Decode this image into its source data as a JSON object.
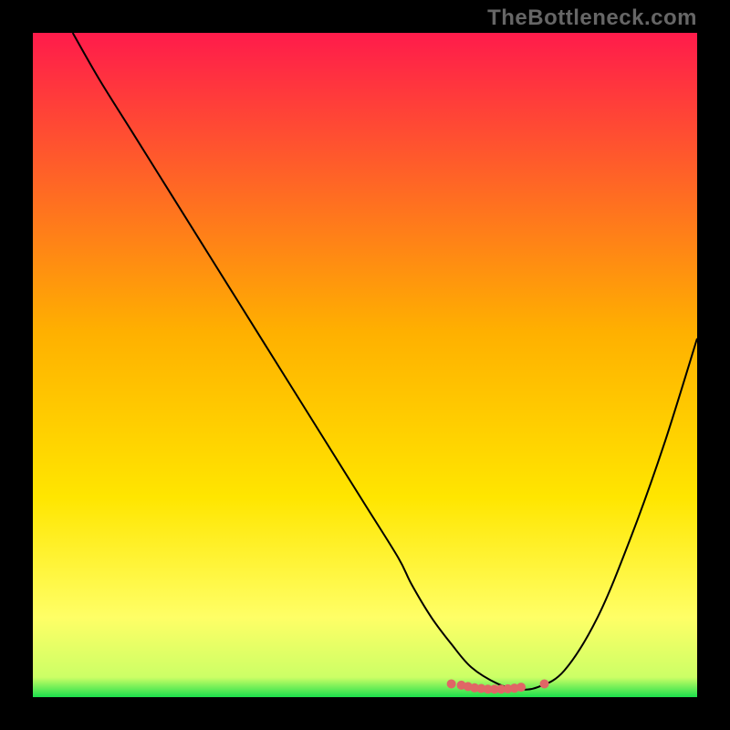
{
  "watermark": "TheBottleneck.com",
  "chart_data": {
    "type": "line",
    "title": "",
    "xlabel": "",
    "ylabel": "",
    "xlim": [
      0,
      100
    ],
    "ylim": [
      0,
      100
    ],
    "grid": false,
    "legend": false,
    "gradient": {
      "stops": [
        {
          "offset": 0.0,
          "color": "#ff1b4b"
        },
        {
          "offset": 0.45,
          "color": "#ffb000"
        },
        {
          "offset": 0.7,
          "color": "#ffe600"
        },
        {
          "offset": 0.88,
          "color": "#ffff66"
        },
        {
          "offset": 0.97,
          "color": "#ccff66"
        },
        {
          "offset": 1.0,
          "color": "#1bdf4c"
        }
      ]
    },
    "series": [
      {
        "name": "bottleneck-curve",
        "color": "#000000",
        "width": 2,
        "x": [
          6,
          10,
          15,
          20,
          25,
          30,
          35,
          40,
          45,
          50,
          55,
          57,
          60,
          63,
          66,
          70,
          73,
          76,
          80,
          85,
          90,
          95,
          100
        ],
        "y": [
          100,
          93,
          85,
          77,
          69,
          61,
          53,
          45,
          37,
          29,
          21,
          17,
          12,
          8,
          4.5,
          2,
          1.2,
          1.5,
          4,
          12,
          24,
          38,
          54
        ]
      }
    ],
    "markers": {
      "name": "flat-region-markers",
      "color": "#e06666",
      "radius": 5,
      "x": [
        63,
        64.5,
        65.5,
        66.5,
        67.5,
        68.5,
        69.5,
        70.5,
        71.5,
        72.5,
        73.5,
        77
      ],
      "y": [
        2.0,
        1.8,
        1.6,
        1.4,
        1.3,
        1.2,
        1.2,
        1.2,
        1.25,
        1.35,
        1.5,
        2.0
      ]
    }
  }
}
